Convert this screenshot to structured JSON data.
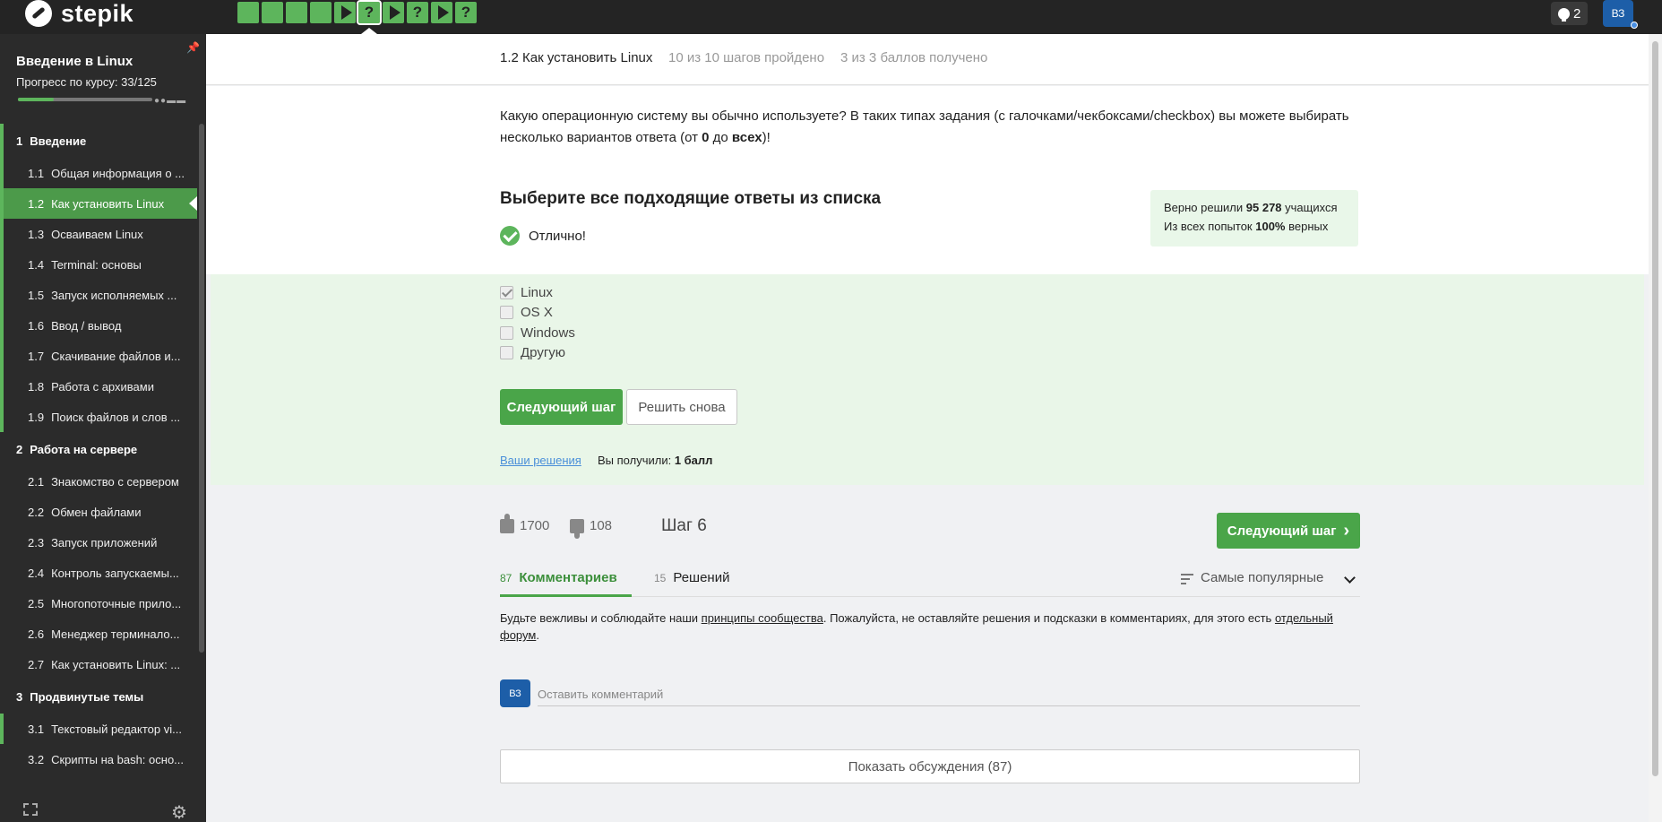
{
  "app": {
    "logo_text": "stepik"
  },
  "topbar": {
    "steps": [
      {
        "kind": "done"
      },
      {
        "kind": "done"
      },
      {
        "kind": "done"
      },
      {
        "kind": "done"
      },
      {
        "kind": "play"
      },
      {
        "kind": "quiz",
        "label": "?",
        "current": true
      },
      {
        "kind": "play"
      },
      {
        "kind": "quiz",
        "label": "?"
      },
      {
        "kind": "play"
      },
      {
        "kind": "quiz",
        "label": "?"
      }
    ],
    "trophy_count": "2",
    "avatar_initials": "ВЗ"
  },
  "sidebar": {
    "course_title": "Введение в Linux",
    "progress_label": "Прогресс по курсу:  33/125",
    "progress_fraction": 0.264,
    "sections": [
      {
        "number": "1",
        "title": "Введение",
        "lessons": [
          {
            "number": "1.1",
            "title": "Общая информация о ..."
          },
          {
            "number": "1.2",
            "title": "Как установить Linux",
            "active": true
          },
          {
            "number": "1.3",
            "title": "Осваиваем Linux"
          },
          {
            "number": "1.4",
            "title": "Terminal: основы"
          },
          {
            "number": "1.5",
            "title": "Запуск исполняемых ..."
          },
          {
            "number": "1.6",
            "title": "Ввод / вывод"
          },
          {
            "number": "1.7",
            "title": "Скачивание файлов и..."
          },
          {
            "number": "1.8",
            "title": "Работа с архивами"
          },
          {
            "number": "1.9",
            "title": "Поиск файлов и слов ..."
          }
        ]
      },
      {
        "number": "2",
        "title": "Работа на сервере",
        "lessons": [
          {
            "number": "2.1",
            "title": "Знакомство с сервером"
          },
          {
            "number": "2.2",
            "title": "Обмен файлами"
          },
          {
            "number": "2.3",
            "title": "Запуск приложений"
          },
          {
            "number": "2.4",
            "title": "Контроль запускаемы..."
          },
          {
            "number": "2.5",
            "title": "Многопоточные прило..."
          },
          {
            "number": "2.6",
            "title": "Менеджер терминало..."
          },
          {
            "number": "2.7",
            "title": "Как установить Linux: ..."
          }
        ]
      },
      {
        "number": "3",
        "title": "Продвинутые темы",
        "lessons": [
          {
            "number": "3.1",
            "title": "Текстовый редактор vi..."
          },
          {
            "number": "3.2",
            "title": "Скрипты на bash: осно..."
          }
        ]
      }
    ]
  },
  "header": {
    "lesson_title": "1.2 Как установить Linux",
    "steps_passed": "10 из 10 шагов пройдено",
    "points": "3 из 3 баллов  получено"
  },
  "question": {
    "text_before": "Какую операционную систему вы обычно используете? В таких типах задания (с галочками/чекбоксами/checkbox) вы можете выбирать несколько вариантов ответа (от ",
    "bold1": "0",
    "text_mid": " до ",
    "bold2": "всех",
    "text_after": ")!",
    "choose_title": "Выберите все подходящие ответы из списка",
    "result": "Отлично!"
  },
  "stats": {
    "line1_prefix": "Верно решили ",
    "line1_value": "95 278",
    "line1_suffix": " учащихся",
    "line2_prefix": "Из всех попыток ",
    "line2_value": "100%",
    "line2_suffix": " верных"
  },
  "options": [
    {
      "label": "Linux",
      "checked": true
    },
    {
      "label": "OS X",
      "checked": false
    },
    {
      "label": "Windows",
      "checked": false
    },
    {
      "label": "Другую",
      "checked": false
    }
  ],
  "actions": {
    "next_step": "Следующий шаг",
    "solve_again": "Решить снова",
    "your_solutions": "Ваши решения",
    "got_prefix": "Вы получили: ",
    "got_value": "1 балл"
  },
  "footer": {
    "likes": "1700",
    "dislikes": "108",
    "step_label": "Шаг 6",
    "next_step": "Следующий шаг",
    "next_arrow": "›"
  },
  "tabs": [
    {
      "count": "87",
      "label": "Комментариев",
      "active": true
    },
    {
      "count": "15",
      "label": "Решений",
      "active": false
    }
  ],
  "sort": {
    "label": "Самые популярные"
  },
  "rules": {
    "part1": "Будьте вежливы и соблюдайте наши ",
    "link1": "принципы сообщества",
    "part2": ". Пожалуйста, не оставляйте решения и подсказки в комментариях, для этого есть ",
    "link2": "отдельный форум",
    "part3": "."
  },
  "comment": {
    "avatar_initials": "ВЗ",
    "placeholder": "Оставить комментарий"
  },
  "show_discussions": "Показать обсуждения (87)",
  "colors": {
    "accent": "#4aa549",
    "sidebar_bg": "#2b2b2b",
    "topbar_bg": "#242424",
    "success_bg": "#e9f6e8"
  }
}
